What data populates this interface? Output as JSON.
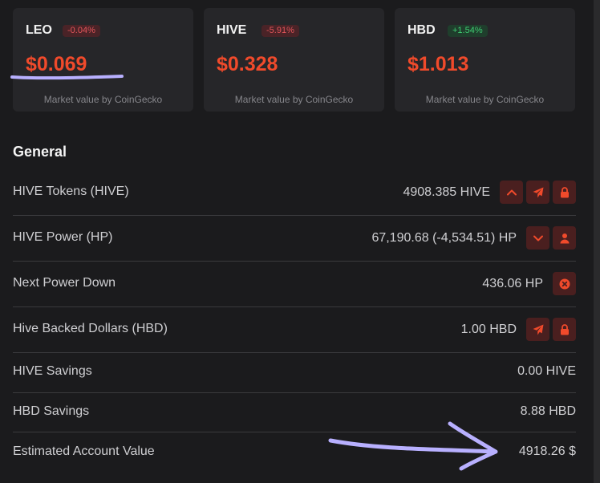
{
  "tokens": [
    {
      "name": "LEO",
      "change": "-0.04%",
      "trend": "negative",
      "price": "$0.069",
      "source": "Market value by CoinGecko"
    },
    {
      "name": "HIVE",
      "change": "-5.91%",
      "trend": "negative",
      "price": "$0.328",
      "source": "Market value by CoinGecko"
    },
    {
      "name": "HBD",
      "change": "+1.54%",
      "trend": "positive",
      "price": "$1.013",
      "source": "Market value by CoinGecko"
    }
  ],
  "general": {
    "title": "General",
    "rows": [
      {
        "label": "HIVE Tokens (HIVE)",
        "value": "4908.385 HIVE",
        "actions": [
          "chevron-up-icon",
          "send-icon",
          "lock-icon"
        ]
      },
      {
        "label": "HIVE Power (HP)",
        "value": "67,190.68 (-4,534.51) HP",
        "actions": [
          "chevron-down-icon",
          "user-icon"
        ]
      },
      {
        "label": "Next Power Down",
        "value": "436.06 HP",
        "actions": [
          "close-circle-icon"
        ]
      },
      {
        "label": "Hive Backed Dollars (HBD)",
        "value": "1.00 HBD",
        "actions": [
          "send-icon",
          "lock-icon"
        ]
      },
      {
        "label": "HIVE Savings",
        "value": "0.00 HIVE",
        "actions": []
      },
      {
        "label": "HBD Savings",
        "value": "8.88 HBD",
        "actions": []
      },
      {
        "label": "Estimated Account Value",
        "value": "4918.26 $",
        "actions": []
      }
    ]
  },
  "colors": {
    "accent": "#f04a2b",
    "negative_badge": "#e2555a",
    "positive_badge": "#3fcc72",
    "annotation": "#b8b0ff",
    "background": "#1b1b1d",
    "card": "#262629"
  }
}
